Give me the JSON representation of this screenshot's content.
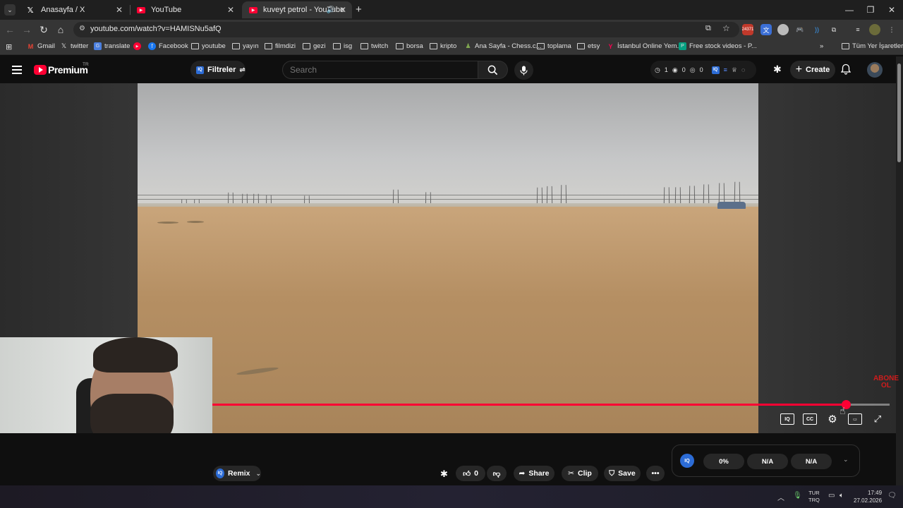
{
  "browser": {
    "tabs": [
      {
        "title": "Anasayfa / X",
        "icon": "x-logo-icon"
      },
      {
        "title": "YouTube",
        "icon": "youtube-icon"
      },
      {
        "title": "kuveyt petrol - YouTube",
        "icon": "youtube-icon",
        "active": true
      }
    ],
    "url": "youtube.com/watch?v=HAMISNu5afQ",
    "extension_badge": "24371",
    "bookmarks": [
      {
        "label": "Gmail",
        "icon": "gmail-icon"
      },
      {
        "label": "twitter",
        "icon": "x-logo-icon"
      },
      {
        "label": "translate",
        "icon": "translate-icon"
      },
      {
        "label": "",
        "icon": "youtube-icon"
      },
      {
        "label": "Facebook",
        "icon": "facebook-icon"
      },
      {
        "label": "youtube",
        "icon": "folder-icon"
      },
      {
        "label": "yayın",
        "icon": "folder-icon"
      },
      {
        "label": "filmdizi",
        "icon": "folder-icon"
      },
      {
        "label": "gezi",
        "icon": "folder-icon"
      },
      {
        "label": "isg",
        "icon": "folder-icon"
      },
      {
        "label": "twitch",
        "icon": "folder-icon"
      },
      {
        "label": "borsa",
        "icon": "folder-icon"
      },
      {
        "label": "kripto",
        "icon": "folder-icon"
      },
      {
        "label": "Ana Sayfa - Chess.c...",
        "icon": "chess-icon"
      },
      {
        "label": "toplama",
        "icon": "folder-icon"
      },
      {
        "label": "etsy",
        "icon": "folder-icon"
      },
      {
        "label": "İstanbul Online Yem...",
        "icon": "yemeksepeti-icon"
      },
      {
        "label": "Free stock videos - P...",
        "icon": "pexels-icon"
      }
    ],
    "all_bookmarks": "Tüm Yer İşaretleri"
  },
  "youtube": {
    "brand": "Premium",
    "region": "TR",
    "filter_label": "Filtreler",
    "search_placeholder": "Search",
    "stats": {
      "clock": "1",
      "views": "0",
      "hidden": "0"
    },
    "create_label": "Create"
  },
  "player": {
    "progress_fraction": 0.935,
    "watermark": "ABONE OL"
  },
  "actions": {
    "remix": "Remix",
    "likes": "0",
    "share": "Share",
    "clip": "Clip",
    "save": "Save"
  },
  "iq_metrics": [
    "0%",
    "N/A",
    "N/A"
  ],
  "taskbar": {
    "lang_top": "TUR",
    "lang_bottom": "TRQ",
    "time": "17:49",
    "date": "27.02.2026"
  },
  "colors": {
    "accent": "#ff0033",
    "iq_blue": "#2c6cd6"
  }
}
